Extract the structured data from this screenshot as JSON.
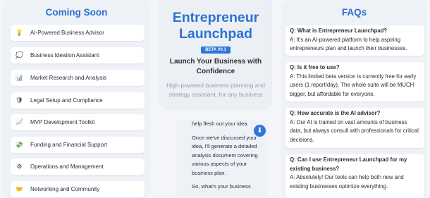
{
  "coming_soon": {
    "title": "Coming Soon",
    "items": [
      {
        "icon": "lightbulb-icon",
        "glyph": "💡",
        "label": "AI-Powered Business Advisor"
      },
      {
        "icon": "speech-bubble-icon",
        "glyph": "💭",
        "label": "Business Ideation Assistant"
      },
      {
        "icon": "bar-chart-icon",
        "glyph": "📊",
        "label": "Market Research and Analysis"
      },
      {
        "icon": "shield-icon",
        "glyph": "🛡",
        "label": "Legal Setup and Compliance"
      },
      {
        "icon": "trend-chart-icon",
        "glyph": "📈",
        "label": "MVP Development Toolkit"
      },
      {
        "icon": "money-icon",
        "glyph": "💸",
        "label": "Funding and Financial Support"
      },
      {
        "icon": "gear-icon",
        "glyph": "⚙",
        "label": "Operations and Management"
      },
      {
        "icon": "handshake-icon",
        "glyph": "🤝",
        "label": "Networking and Community"
      }
    ]
  },
  "hero": {
    "title_line1": "Entrepreneur",
    "title_line2": "Launchpad",
    "badge": "BETA V0.1",
    "tagline_line1": "Launch Your Business with",
    "tagline_line2": "Confidence",
    "subtitle": "High-powered business planning and strategy assistant, for any business"
  },
  "chat": {
    "lines": [
      "help flesh out your idea.",
      "Once we've discussed your idea, I'll generate a detailed analysis document covering various aspects of your business plan.",
      "So, what's your business"
    ]
  },
  "faqs": {
    "title": "FAQs",
    "items": [
      {
        "q": "Q: What is Entrepreneur Launchpad?",
        "a": "A: It's an AI-powered platform to help aspiring entrepreneurs plan and launch their businesses."
      },
      {
        "q": "Q: Is it free to use?",
        "a": "A: This limited beta version is currently free for early users (1 report/day). The whole suite will be MUCH bigger, but affordable for everyone."
      },
      {
        "q": "Q: How accurate is the AI advisor?",
        "a": "A: Our AI is trained on vast amounts of business data, but always consult with professionals for critical decisions."
      },
      {
        "q": "Q: Can I use Entrepreneur Launchpad for my existing business?",
        "a": "A: Absolutely! Our tools can help both new and existing businesses optimize everything."
      }
    ]
  },
  "colors": {
    "accent": "#2b6fd0",
    "badge": "#2f76dc",
    "panel": "#eef1f6"
  }
}
